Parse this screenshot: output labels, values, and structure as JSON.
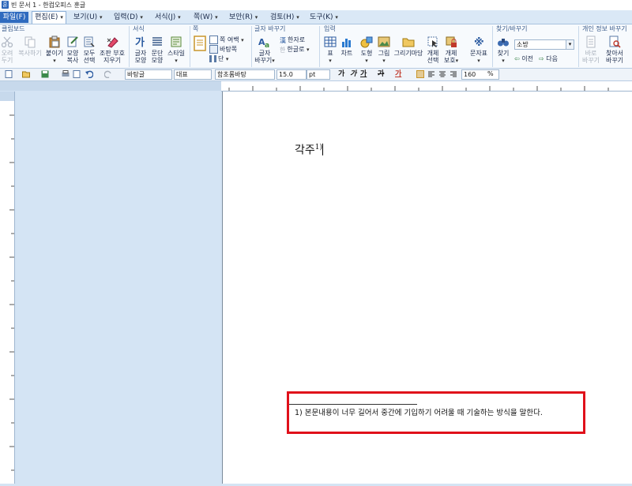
{
  "window": {
    "title": "빈 문서 1 - 한컴오피스 훈글"
  },
  "menu": [
    {
      "label": "파일(F)"
    },
    {
      "label": "편집(E)"
    },
    {
      "label": "보기(U)"
    },
    {
      "label": "입력(D)"
    },
    {
      "label": "서식(J)"
    },
    {
      "label": "쪽(W)"
    },
    {
      "label": "보안(R)"
    },
    {
      "label": "검토(H)"
    },
    {
      "label": "도구(K)"
    }
  ],
  "ribbon": {
    "groups": {
      "clipboard": "클립보드",
      "format": "서식",
      "page": "쪽",
      "replace_chars": "글자 바꾸기",
      "insert": "입력",
      "find_replace": "찾기/바꾸기",
      "personal": "개인 정보 바꾸기"
    },
    "buttons": {
      "cut": "오려\n두기",
      "copy": "복사하기",
      "paste": "붙이기",
      "format_copy": "모양\n복사",
      "select_all": "모두\n선택",
      "remove_ctrl": "조판 부호\n지우기",
      "char_shape": "글자\n모양",
      "para_shape": "문단\n모양",
      "style": "스타일",
      "page_margin": "쪽 여백",
      "page_bg": "바탕쪽",
      "columns": "단",
      "char_replace": "글자\n바꾸기",
      "hanja": "한자로",
      "hangul": "한글로",
      "table": "표",
      "chart": "차트",
      "shape": "도형",
      "picture": "그림",
      "gallery": "그리기마당",
      "obj_select": "개체\n선택",
      "obj_protect": "개체\n보호",
      "symbols": "문자표",
      "find": "찾기",
      "find_value": "소방",
      "prev": "이전",
      "next": "다음",
      "privacy_replace": "바로\n바꾸기",
      "find_replace_btn": "찾아서\n바꾸기"
    }
  },
  "format_bar": {
    "style": "바탕글",
    "lang": "대표",
    "font": "함초롬바탕",
    "size": "15.0",
    "unit": "pt",
    "zoom": "160",
    "zoom_unit": "%",
    "bold": "가",
    "italic": "가",
    "underline": "가",
    "strike": "가",
    "color": "가"
  },
  "document": {
    "body_text": "각주",
    "body_superscript": "1)",
    "footnote": "1) 본문내용이 너무 길어서 중간에 기입하기 어려울 때 기술하는 방식을 말한다."
  },
  "colors": {
    "highlight": "#e0101a",
    "accent": "#2f6bbf"
  }
}
